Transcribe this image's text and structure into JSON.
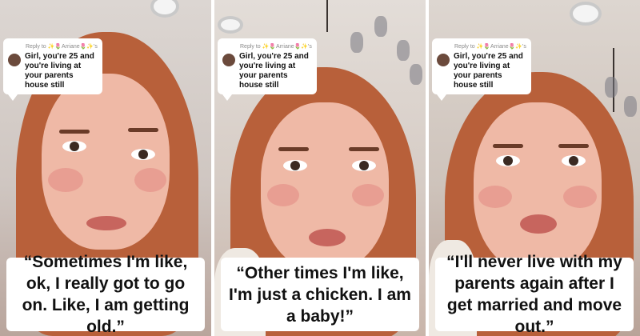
{
  "panels": [
    {
      "comment": {
        "reply_label": "Reply to ✨🌷Arriane🌷✨'s comment",
        "text": "Girl, you're 25 and you're living at your parents house still"
      },
      "caption": "“Sometimes I'm like, ok, I really got to go on. Like, I am getting old.”"
    },
    {
      "comment": {
        "reply_label": "Reply to ✨🌷Arriane🌷✨'s comment",
        "text": "Girl, you're 25 and you're living at your parents house still"
      },
      "caption": "“Other times I'm like, I'm just a chicken. I am a baby!”"
    },
    {
      "comment": {
        "reply_label": "Reply to ✨🌷Arriane🌷✨'s comment",
        "text": "Girl, you're 25 and you're living at your parents house still"
      },
      "caption": "“I'll never live with my parents again after I get married and move out.”"
    }
  ]
}
